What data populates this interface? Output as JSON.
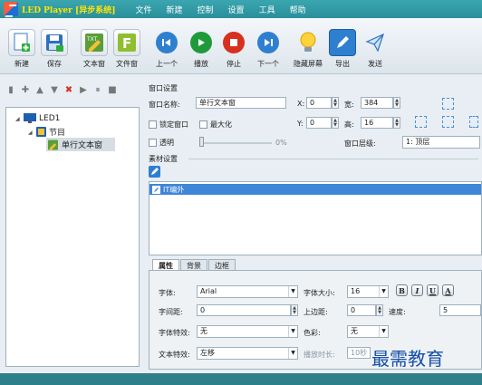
{
  "app": {
    "title": "LED Player [异步系统]"
  },
  "menu": [
    "文件",
    "新建",
    "控制",
    "设置",
    "工具",
    "帮助"
  ],
  "toolbar": {
    "new": "新建",
    "save": "保存",
    "text_window": "文本窗",
    "file_window": "文件窗",
    "prev": "上一个",
    "play": "播放",
    "stop": "停止",
    "next": "下一个",
    "hide_screen": "隐藏屏幕",
    "export": "导出",
    "send": "发送"
  },
  "tree": {
    "root": "LED1",
    "program": "节目",
    "item": "单行文本窗"
  },
  "window_settings": {
    "section": "窗口设置",
    "name_label": "窗口名称:",
    "name_value": "单行文本窗",
    "x_label": "X:",
    "x_value": "0",
    "width_label": "宽:",
    "width_value": "384",
    "y_label": "Y:",
    "y_value": "0",
    "height_label": "高:",
    "height_value": "16",
    "lock_label": "锁定窗口",
    "maximize_label": "最大化",
    "transparent_label": "透明",
    "transparency_value": "0%",
    "layer_label": "窗口层级:",
    "layer_value": "1: 顶层"
  },
  "material": {
    "section": "素材设置",
    "item": "IT编外"
  },
  "props": {
    "tabs": [
      "属性",
      "背景",
      "边框"
    ],
    "font_label": "字体:",
    "font_value": "Arial",
    "font_size_label": "字体大小:",
    "font_size_value": "16",
    "bold": "B",
    "italic": "I",
    "underline": "U",
    "shadow": "A",
    "spacing_label": "字间距:",
    "spacing_value": "0",
    "top_margin_label": "上边距:",
    "top_margin_value": "0",
    "speed_label": "速度:",
    "speed_value": "5",
    "font_effect_label": "字体特效:",
    "font_effect_value": "无",
    "color_label": "色彩:",
    "color_value": "无",
    "text_effect_label": "文本特效:",
    "text_effect_value": "左移",
    "duration_label": "播放时长:",
    "duration_value": "10秒"
  },
  "watermark": "最需教育",
  "colors": {
    "titlebar": "#2a8f9a",
    "selection": "#3d86d8",
    "title_text": "#ffe600"
  }
}
